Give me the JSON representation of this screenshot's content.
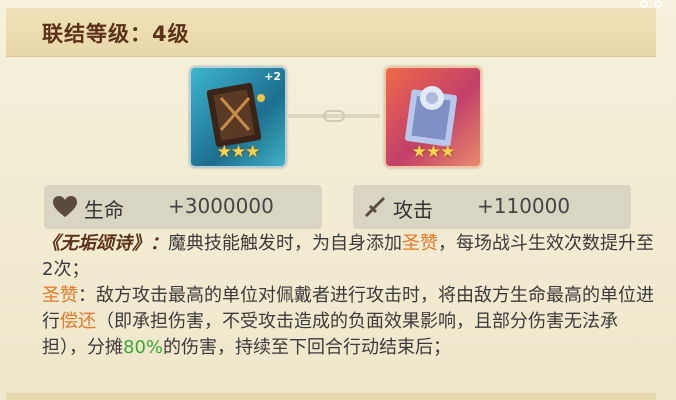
{
  "header": {
    "title": "联结等级：4级"
  },
  "cards": {
    "left": {
      "bonus": "+2"
    },
    "right": {
      "bonus": ""
    }
  },
  "stats": {
    "hp": {
      "label": "生命",
      "value": "+3000000",
      "icon": "heart-icon"
    },
    "atk": {
      "label": "攻击",
      "value": "+110000",
      "icon": "sword-icon"
    }
  },
  "description": {
    "name": "《无垢颂诗》：",
    "line1_a": "魔典技能触发时，为自身添加",
    "buff": "圣赞",
    "line1_b": "，每场战斗生效次数提升至2次；",
    "buff_label": "圣赞",
    "line2_a": "：敌方攻击最高的单位对佩戴者进行攻击时，将由敌方生命最高的单位进行",
    "repay": "偿还",
    "line2_b": "（即承担伤害，不受攻击造成的负面效果影响，且部分伤害无法承担），分摊",
    "percent": "80%",
    "line2_c": "的伤害，持续至下回合行动结束后；"
  }
}
